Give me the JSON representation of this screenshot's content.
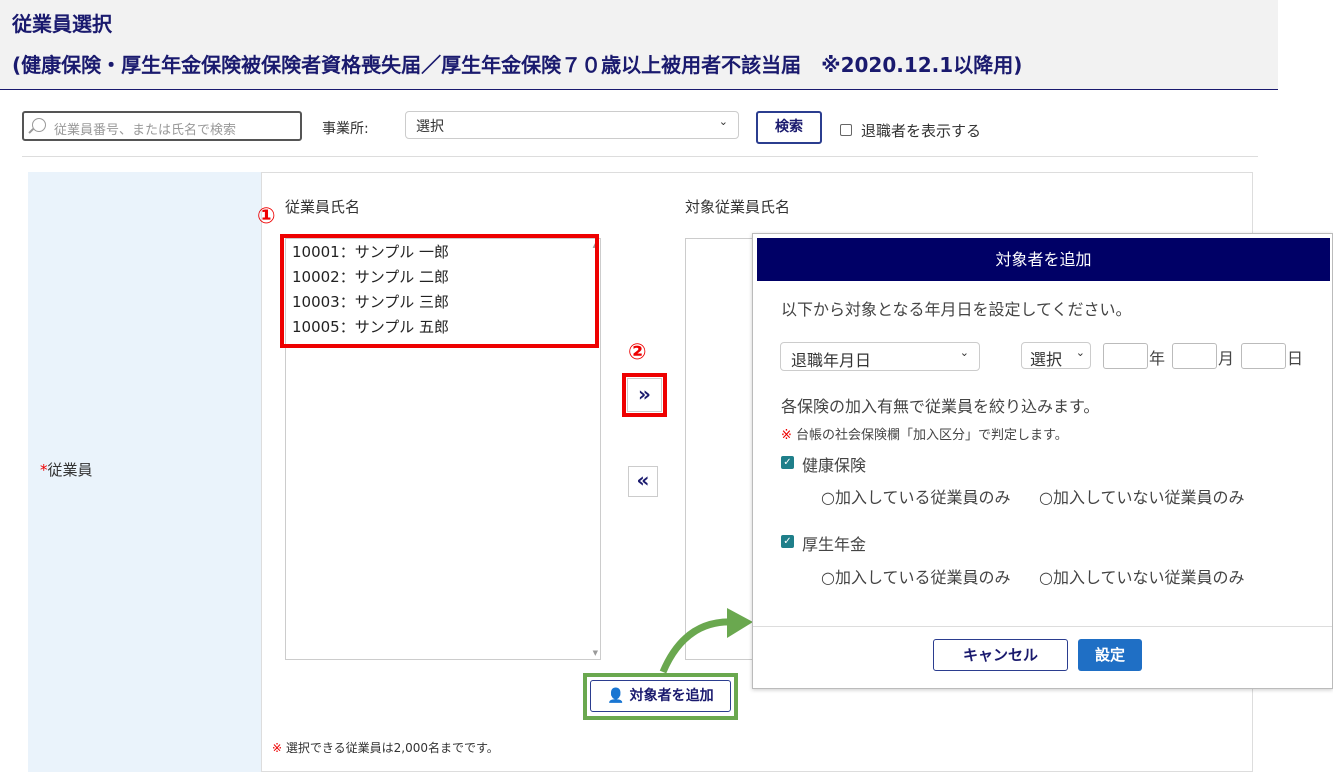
{
  "header": {
    "title": "従業員選択",
    "subtitle": "(健康保険・厚生年金保険被保険者資格喪失届／厚生年金保険７０歳以上被用者不該当届　※2020.12.1以降用)"
  },
  "toolbar": {
    "search_placeholder": "従業員番号、または氏名で検索",
    "office_label": "事業所:",
    "office_value": "選択",
    "search_button": "検索",
    "show_retired_label": "退職者を表示する"
  },
  "form": {
    "field_required_mark": "*",
    "field_label": "従業員",
    "left_list_label": "従業員氏名",
    "right_list_label": "対象従業員氏名",
    "employees": [
      "10001：サンプル 一郎",
      "10002：サンプル 二郎",
      "10003：サンプル 三郎",
      "10005：サンプル 五郎"
    ],
    "add_button": "»",
    "remove_button": "«",
    "add_target_button": "対象者を追加",
    "note_mark": "※",
    "note": "選択できる従業員は2,000名までです。"
  },
  "annotations": {
    "step1": "①",
    "step2": "②",
    "colors": {
      "highlight": "#e00000",
      "arrow": "#6aa84f"
    }
  },
  "dialog": {
    "title": "対象者を追加",
    "instruction": "以下から対象となる年月日を設定してください。",
    "date_type": "退職年月日",
    "era": "選択",
    "year_unit": "年",
    "month_unit": "月",
    "day_unit": "日",
    "filter_text": "各保険の加入有無で従業員を絞り込みます。",
    "note_mark": "※",
    "note": "台帳の社会保険欄「加入区分」で判定します。",
    "insurances": [
      {
        "label": "健康保険",
        "checked": true,
        "option_enrolled": "○加入している従業員のみ",
        "option_not_enrolled": "○加入していない従業員のみ"
      },
      {
        "label": "厚生年金",
        "checked": true,
        "option_enrolled": "○加入している従業員のみ",
        "option_not_enrolled": "○加入していない従業員のみ"
      }
    ],
    "cancel": "キャンセル",
    "ok": "設定"
  }
}
